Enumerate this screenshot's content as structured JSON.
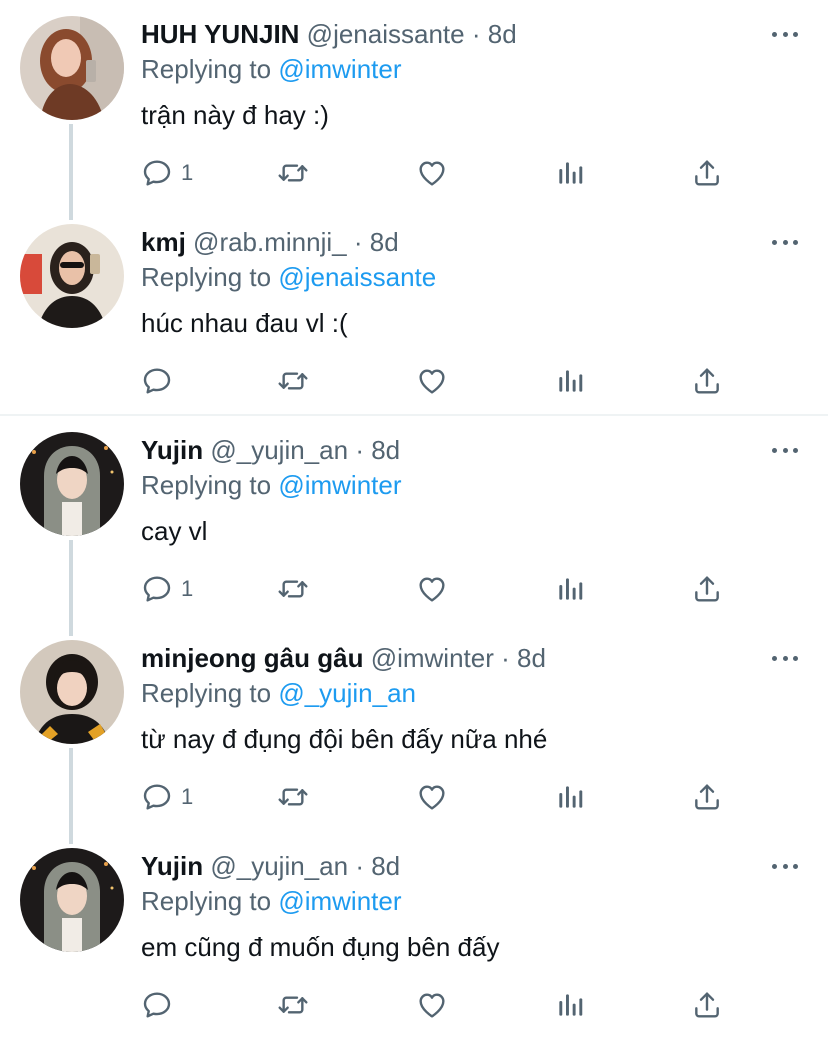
{
  "replying_label": "Replying to",
  "tweets": [
    {
      "name": "HUH YUNJIN",
      "handle": "@jenaissante",
      "dot": "·",
      "time": "8d",
      "reply_to": "@imwinter",
      "text": "trận này đ hay :)",
      "reply_count": "1"
    },
    {
      "name": "kmj",
      "handle": "@rab.minnji_",
      "dot": "·",
      "time": "8d",
      "reply_to": "@jenaissante",
      "text": "húc nhau đau vl :(",
      "reply_count": ""
    },
    {
      "name": "Yujin",
      "handle": "@_yujin_an",
      "dot": "·",
      "time": "8d",
      "reply_to": "@imwinter",
      "text": "cay vl",
      "reply_count": "1"
    },
    {
      "name": "minjeong gâu gâu",
      "handle": "@imwinter",
      "dot": "·",
      "time": "8d",
      "reply_to": "@_yujin_an",
      "text": "từ nay đ đụng đội bên đấy nữa nhé",
      "reply_count": "1"
    },
    {
      "name": "Yujin",
      "handle": "@_yujin_an",
      "dot": "·",
      "time": "8d",
      "reply_to": "@imwinter",
      "text": "em cũng đ muốn đụng bên đấy",
      "reply_count": ""
    }
  ],
  "icons": {
    "reply": "reply-icon",
    "retweet": "retweet-icon",
    "like": "heart-icon",
    "views": "analytics-icon",
    "share": "share-icon",
    "more": "more-icon"
  },
  "colors": {
    "link": "#1d9bf0",
    "secondary": "#536471",
    "thread_line": "#cfd9de"
  }
}
